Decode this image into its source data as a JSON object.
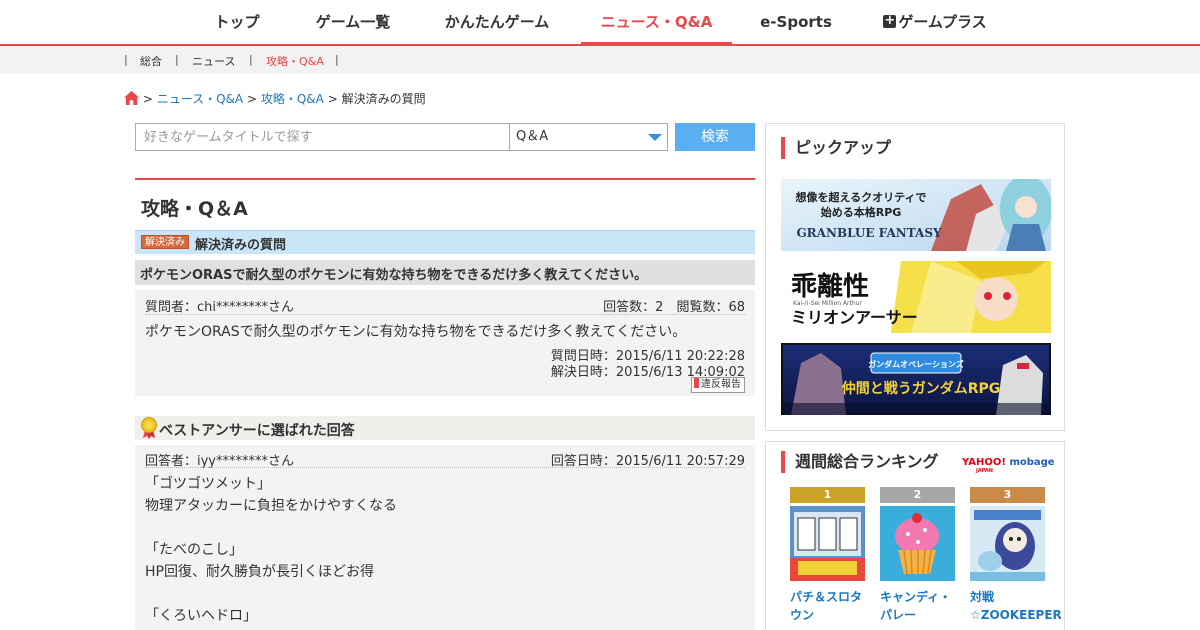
{
  "topnav": {
    "items": [
      {
        "label": "トップ"
      },
      {
        "label": "ゲーム一覧"
      },
      {
        "label": "かんたんゲーム"
      },
      {
        "label": "ニュース・Q&A"
      },
      {
        "label": "e-Sports"
      },
      {
        "label": "ゲームプラス"
      }
    ],
    "active_index": 3,
    "accent": "#e8474b"
  },
  "subnav": {
    "items": [
      {
        "label": "総合"
      },
      {
        "label": "ニュース"
      },
      {
        "label": "攻略・Q&A"
      }
    ],
    "separator": "|"
  },
  "breadcrumb": {
    "separator": ">",
    "items": [
      {
        "label": "ニュース・Q&A"
      },
      {
        "label": "攻略・Q&A"
      },
      {
        "label": "解決済みの質問"
      }
    ]
  },
  "search": {
    "placeholder": "好きなゲームタイトルで探す",
    "category_value": "Q＆A",
    "button_label": "検索"
  },
  "main": {
    "page_title": "攻略・Q＆A",
    "solved_badge": "解決済み",
    "solved_label": "解決済みの質問",
    "question": {
      "title": "ポケモンORASで耐久型のポケモンに有効な持ち物をできるだけ多く教えてください。",
      "asker": "質問者：chi********さん",
      "stats": "回答数：2　閲覧数：68",
      "body": "ポケモンORASで耐久型のポケモンに有効な持ち物をできるだけ多く教えてください。",
      "asked_at": "質問日時：2015/6/11 20:22:28",
      "resolved_at": "解決日時：2015/6/13 14:09:02",
      "report_label": "違反報告"
    },
    "best_answer": {
      "heading": "ベストアンサーに選ばれた回答",
      "answerer": "回答者：iyy********さん",
      "answered_at": "回答日時：2015/6/11 20:57:29",
      "lines": [
        "「ゴツゴツメット」",
        "物理アタッカーに負担をかけやすくなる",
        "",
        "「たべのこし」",
        "HP回復、耐久勝負が長引くほどお得",
        "",
        "「くろいヘドロ」"
      ]
    }
  },
  "sidebar": {
    "pickup_title": "ピックアップ",
    "banners": [
      {
        "caption_1": "想像を超えるクオリティで",
        "caption_2": "始める本格RPG",
        "logo": "GRANBLUE FANTASY"
      },
      {
        "title": "乖離性",
        "subtitle": "ミリオンアーサー",
        "small": "Kai-ri-Sei Million Arthur"
      },
      {
        "title": "仲間と戦うガンダムRPG",
        "small": "ガンダムオペレーションズ"
      }
    ],
    "ranking_title": "週間総合ランキング",
    "ranking_logo": {
      "yahoo": "YAHOO!",
      "yahoo_sub": "JAPAN",
      "mobage": "mobage"
    },
    "ranking": [
      {
        "rank": "1",
        "name": "パチ＆スロタウン",
        "color": "#c9a227"
      },
      {
        "rank": "2",
        "name": "キャンディ・パレー",
        "color": "#a6a6a6"
      },
      {
        "rank": "3",
        "name": "対戦☆ZOOKEEPER",
        "color": "#c98a4a"
      }
    ]
  }
}
